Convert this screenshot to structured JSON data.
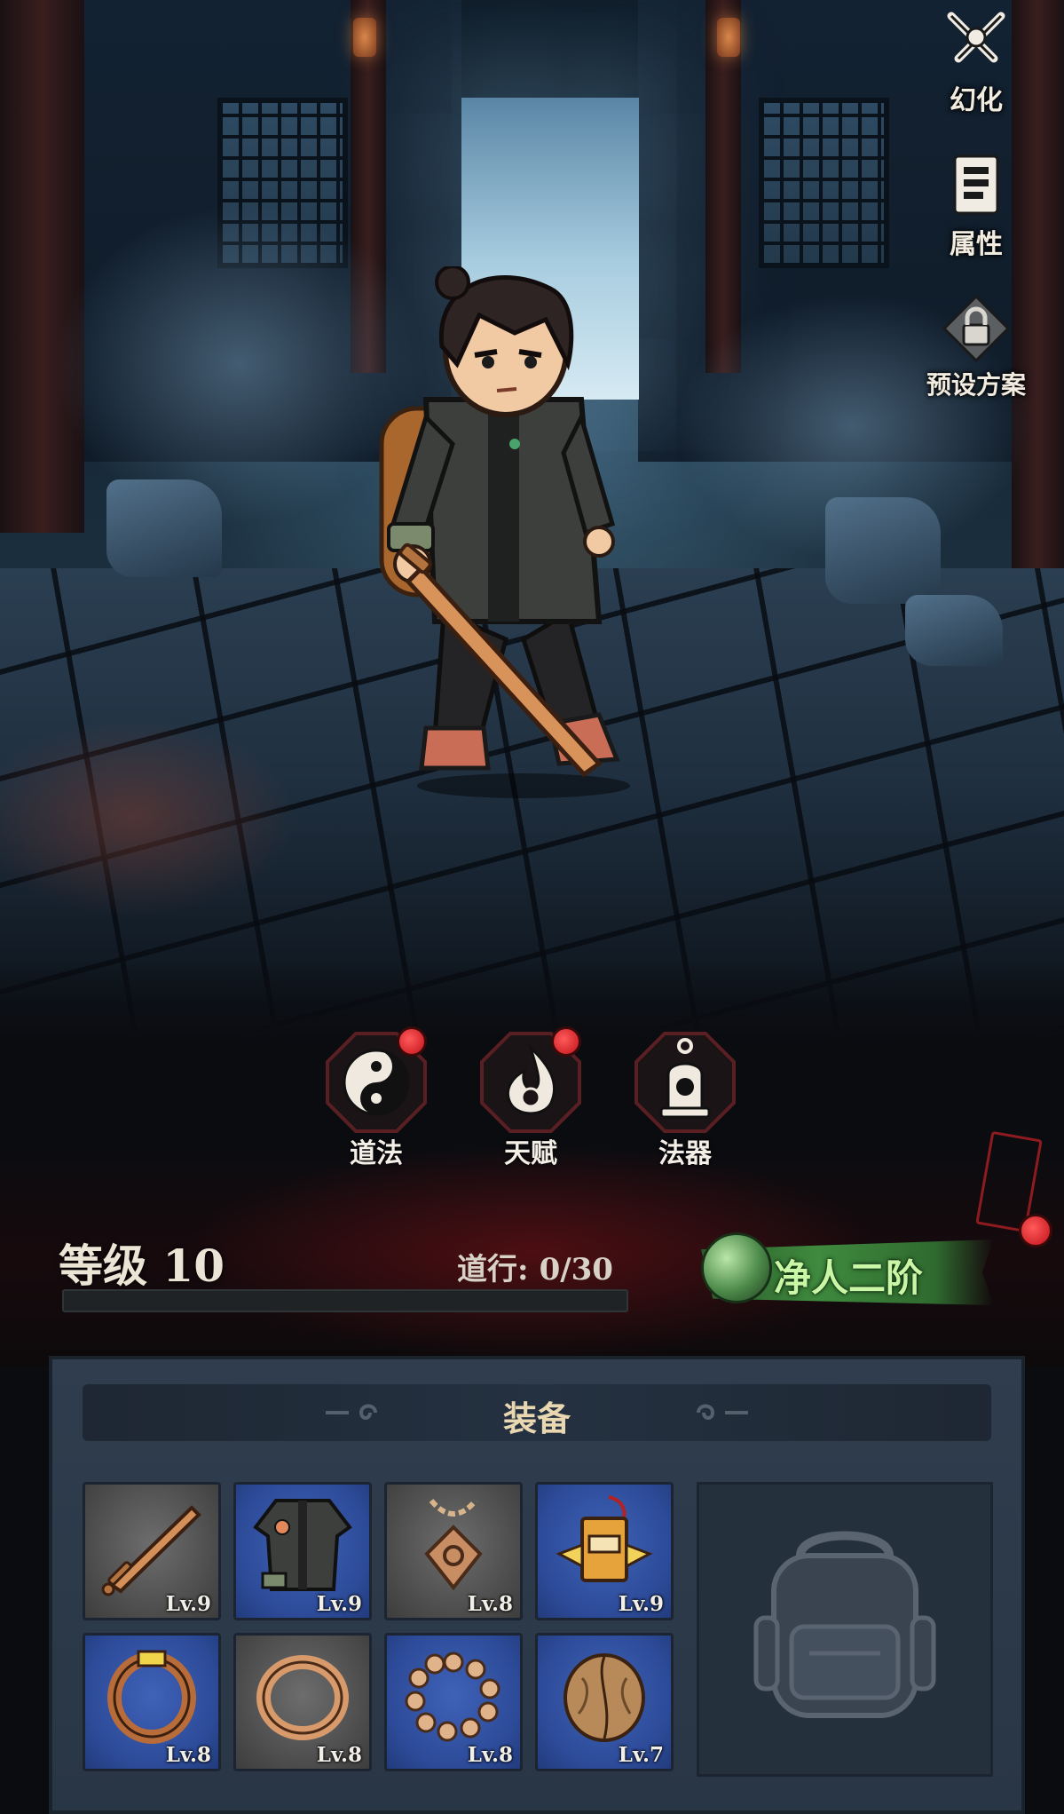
{
  "side_menu": [
    {
      "id": "huanhua",
      "label": "幻化",
      "icon": "crossed-swords-icon"
    },
    {
      "id": "shuxing",
      "label": "属性",
      "icon": "scroll-stats-icon"
    },
    {
      "id": "yushe",
      "label": "预设方案",
      "icon": "preset-lock-icon"
    }
  ],
  "skills": [
    {
      "label": "道法",
      "icon": "yin-yang-icon",
      "has_notification": true
    },
    {
      "label": "天赋",
      "icon": "spirit-flame-icon",
      "has_notification": true
    },
    {
      "label": "法器",
      "icon": "bell-icon",
      "has_notification": false
    }
  ],
  "level": {
    "label": "等级 10",
    "dao_label": "道行:",
    "dao_value": "0/30",
    "progress": 0
  },
  "realm": {
    "label": "净人二阶"
  },
  "equipment": {
    "title": "装备",
    "slots": [
      {
        "item": "sword-icon",
        "level": "Lv.9",
        "rarity": "gray"
      },
      {
        "item": "jacket-icon",
        "level": "Lv.9",
        "rarity": "blue"
      },
      {
        "item": "amulet-icon",
        "level": "Lv.8",
        "rarity": "gray"
      },
      {
        "item": "talisman-icon",
        "level": "Lv.9",
        "rarity": "blue"
      },
      {
        "item": "ring-band-icon",
        "level": "Lv.8",
        "rarity": "blue"
      },
      {
        "item": "ring-icon",
        "level": "Lv.8",
        "rarity": "gray"
      },
      {
        "item": "prayer-beads-icon",
        "level": "Lv.8",
        "rarity": "blue"
      },
      {
        "item": "walnut-icon",
        "level": "Lv.7",
        "rarity": "blue"
      }
    ],
    "bag_icon": "backpack-icon"
  },
  "colors": {
    "realm_green": "#3f8a3e",
    "notification_red": "#c1121a",
    "rarity_blue": "#2c4a97",
    "rarity_gray": "#4b4b4b"
  }
}
